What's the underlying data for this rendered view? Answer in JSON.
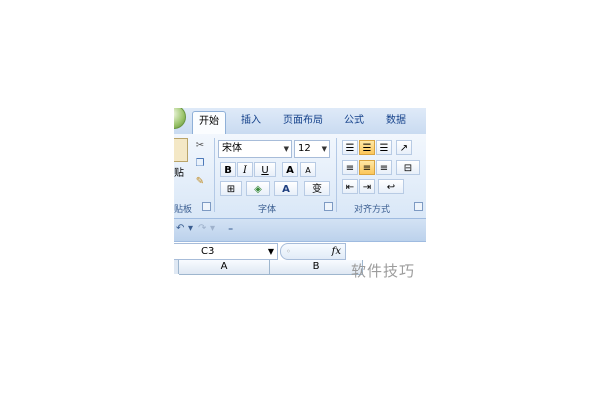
{
  "tabs": [
    "开始",
    "插入",
    "页面布局",
    "公式",
    "数据"
  ],
  "active_tab": "开始",
  "clipboard": {
    "paste_label": "贴",
    "group_label": "贴板"
  },
  "font": {
    "name": "宋体",
    "size": "12",
    "bold": "B",
    "italic": "I",
    "underline": "U",
    "grow": "A",
    "shrink": "A",
    "color": "A",
    "phonetic": "变",
    "group_label": "字体"
  },
  "alignment": {
    "group_label": "对齐方式"
  },
  "formula_bar": {
    "cell_ref": "C3",
    "fx": "fx"
  },
  "sheet": {
    "columns": [
      "A",
      "B"
    ]
  },
  "watermark": "软件技巧",
  "icons": [
    "office-orb-icon",
    "cut-icon",
    "copy-icon",
    "format-painter-icon",
    "undo-icon",
    "redo-icon",
    "customize-qat-icon"
  ]
}
